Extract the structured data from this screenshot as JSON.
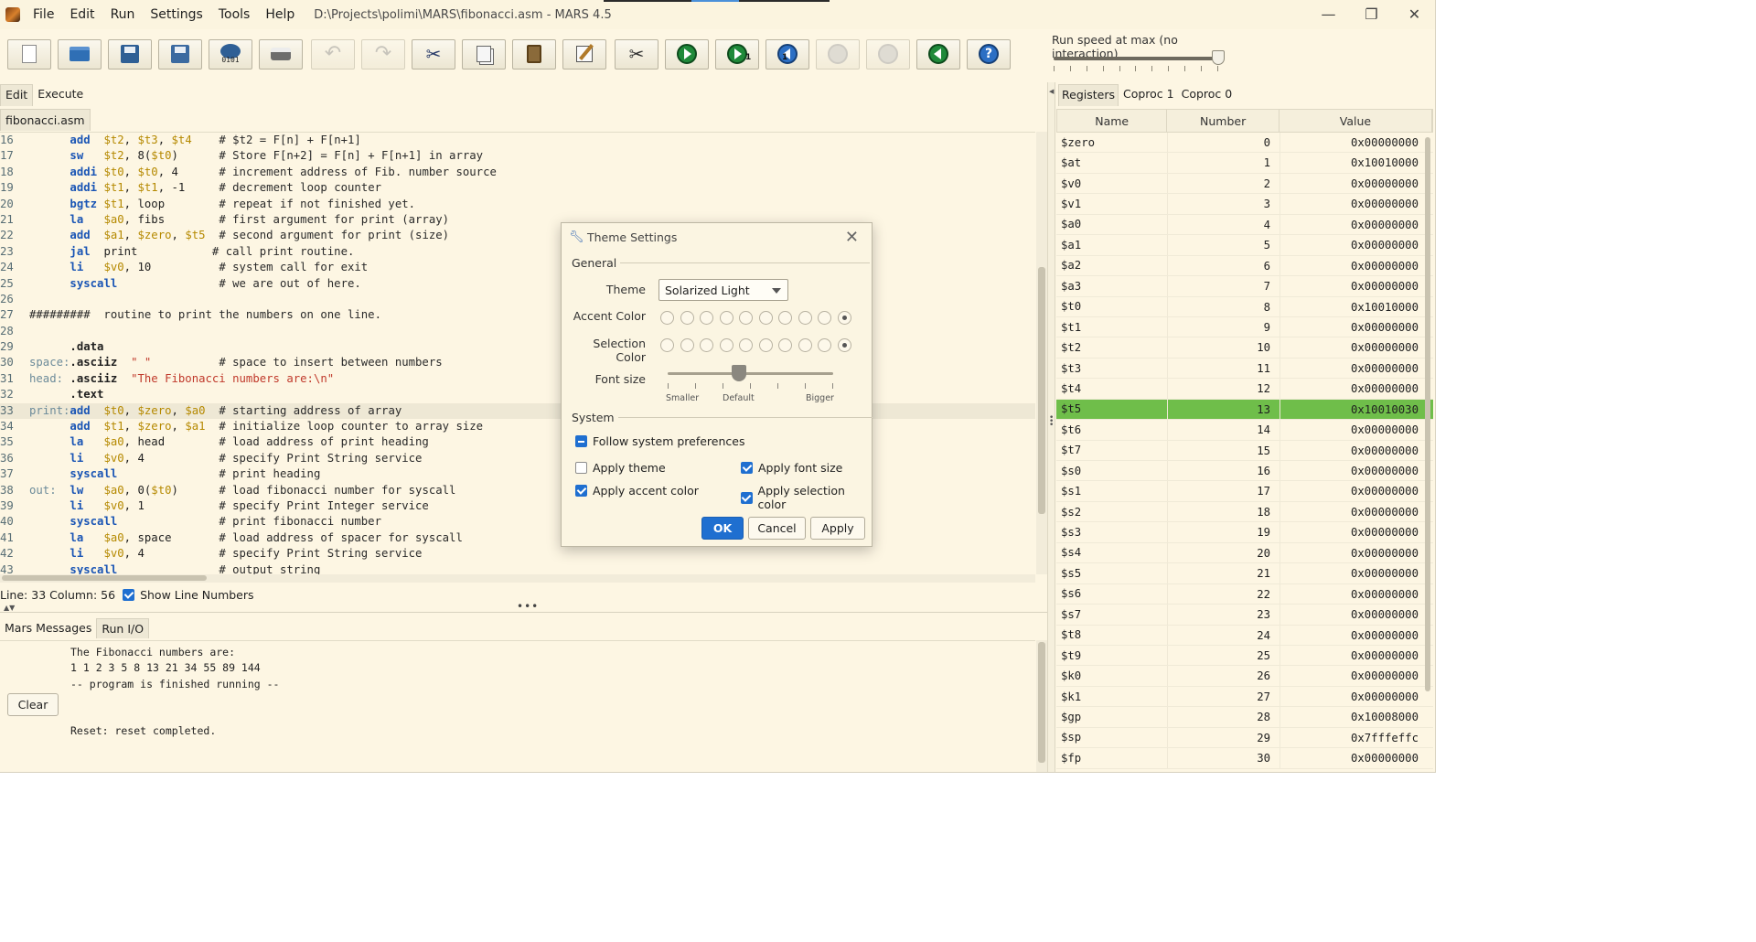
{
  "window": {
    "title": "D:\\Projects\\polimi\\MARS\\fibonacci.asm - MARS 4.5",
    "menu": [
      "File",
      "Edit",
      "Run",
      "Settings",
      "Tools",
      "Help"
    ],
    "controls": {
      "minimize": "—",
      "maximize": "❐",
      "close": "✕"
    }
  },
  "toolbar": {
    "buttons": [
      {
        "name": "new-file",
        "icon": "new-file-icon",
        "enabled": true
      },
      {
        "name": "open-file",
        "icon": "folder-icon",
        "enabled": true
      },
      {
        "name": "save",
        "icon": "save-icon",
        "enabled": true
      },
      {
        "name": "save-as",
        "icon": "save-as-icon",
        "enabled": true
      },
      {
        "name": "dump-memory",
        "icon": "dump-icon",
        "label": "0101",
        "enabled": true
      },
      {
        "name": "print",
        "icon": "printer-icon",
        "enabled": true
      },
      {
        "name": "undo",
        "icon": "undo-icon",
        "enabled": false
      },
      {
        "name": "redo",
        "icon": "redo-icon",
        "enabled": false
      },
      {
        "name": "cut",
        "icon": "scissors-icon",
        "enabled": true
      },
      {
        "name": "copy",
        "icon": "copy-icon",
        "enabled": true
      },
      {
        "name": "paste",
        "icon": "paste-icon",
        "enabled": true
      },
      {
        "name": "find-replace",
        "icon": "edit-icon",
        "enabled": true
      },
      {
        "name": "assemble",
        "icon": "tools-icon",
        "enabled": true
      },
      {
        "name": "run",
        "icon": "run-icon",
        "enabled": true
      },
      {
        "name": "step",
        "icon": "step-icon",
        "label": "1",
        "enabled": true
      },
      {
        "name": "backstep",
        "icon": "backstep-icon",
        "label": "1",
        "enabled": true
      },
      {
        "name": "pause",
        "icon": "pause-icon",
        "enabled": false
      },
      {
        "name": "stop",
        "icon": "stop-icon",
        "enabled": false
      },
      {
        "name": "reset",
        "icon": "reset-icon",
        "enabled": true
      },
      {
        "name": "help",
        "icon": "help-icon",
        "label": "?",
        "enabled": true
      }
    ]
  },
  "run_speed": {
    "label": "Run speed at max (no interaction)",
    "value_fraction": 1.0
  },
  "left_tabs": [
    "Edit",
    "Execute"
  ],
  "file_tab": "fibonacci.asm",
  "editor": {
    "current_line": 33,
    "lines": [
      {
        "n": "16",
        "parts": [
          [
            "plain",
            "      "
          ],
          [
            "op",
            "add"
          ],
          [
            "plain",
            "  "
          ],
          [
            "reg",
            "$t2"
          ],
          [
            "plain",
            ", "
          ],
          [
            "reg",
            "$t3"
          ],
          [
            "plain",
            ", "
          ],
          [
            "reg",
            "$t4"
          ],
          [
            "plain",
            "    "
          ],
          [
            "cmt",
            "# $t2 = F[n] + F[n+1]"
          ]
        ]
      },
      {
        "n": "17",
        "parts": [
          [
            "plain",
            "      "
          ],
          [
            "op",
            "sw"
          ],
          [
            "plain",
            "   "
          ],
          [
            "reg",
            "$t2"
          ],
          [
            "plain",
            ", 8("
          ],
          [
            "reg",
            "$t0"
          ],
          [
            "plain",
            ")      "
          ],
          [
            "cmt",
            "# Store F[n+2] = F[n] + F[n+1] in array"
          ]
        ]
      },
      {
        "n": "18",
        "parts": [
          [
            "plain",
            "      "
          ],
          [
            "op",
            "addi"
          ],
          [
            "plain",
            " "
          ],
          [
            "reg",
            "$t0"
          ],
          [
            "plain",
            ", "
          ],
          [
            "reg",
            "$t0"
          ],
          [
            "plain",
            ", 4      "
          ],
          [
            "cmt",
            "# increment address of Fib. number source"
          ]
        ]
      },
      {
        "n": "19",
        "parts": [
          [
            "plain",
            "      "
          ],
          [
            "op",
            "addi"
          ],
          [
            "plain",
            " "
          ],
          [
            "reg",
            "$t1"
          ],
          [
            "plain",
            ", "
          ],
          [
            "reg",
            "$t1"
          ],
          [
            "plain",
            ", -1     "
          ],
          [
            "cmt",
            "# decrement loop counter"
          ]
        ]
      },
      {
        "n": "20",
        "parts": [
          [
            "plain",
            "      "
          ],
          [
            "op",
            "bgtz"
          ],
          [
            "plain",
            " "
          ],
          [
            "reg",
            "$t1"
          ],
          [
            "plain",
            ", loop        "
          ],
          [
            "cmt",
            "# repeat if not finished yet."
          ]
        ]
      },
      {
        "n": "21",
        "parts": [
          [
            "plain",
            "      "
          ],
          [
            "op",
            "la"
          ],
          [
            "plain",
            "   "
          ],
          [
            "reg",
            "$a0"
          ],
          [
            "plain",
            ", fibs        "
          ],
          [
            "cmt",
            "# first argument for print (array)"
          ]
        ]
      },
      {
        "n": "22",
        "parts": [
          [
            "plain",
            "      "
          ],
          [
            "op",
            "add"
          ],
          [
            "plain",
            "  "
          ],
          [
            "reg",
            "$a1"
          ],
          [
            "plain",
            ", "
          ],
          [
            "reg",
            "$zero"
          ],
          [
            "plain",
            ", "
          ],
          [
            "reg",
            "$t5"
          ],
          [
            "plain",
            "  "
          ],
          [
            "cmt",
            "# second argument for print (size)"
          ]
        ]
      },
      {
        "n": "23",
        "parts": [
          [
            "plain",
            "      "
          ],
          [
            "op",
            "jal"
          ],
          [
            "plain",
            "  print           "
          ],
          [
            "cmt",
            "# call print routine."
          ]
        ]
      },
      {
        "n": "24",
        "parts": [
          [
            "plain",
            "      "
          ],
          [
            "op",
            "li"
          ],
          [
            "plain",
            "   "
          ],
          [
            "reg",
            "$v0"
          ],
          [
            "plain",
            ", 10          "
          ],
          [
            "cmt",
            "# system call for exit"
          ]
        ]
      },
      {
        "n": "25",
        "parts": [
          [
            "plain",
            "      "
          ],
          [
            "op",
            "syscall"
          ],
          [
            "plain",
            "               "
          ],
          [
            "cmt",
            "# we are out of here."
          ]
        ]
      },
      {
        "n": "26",
        "parts": [
          [
            "plain",
            ""
          ]
        ]
      },
      {
        "n": "27",
        "parts": [
          [
            "cmt",
            "#########  routine to print the numbers on one line."
          ]
        ]
      },
      {
        "n": "28",
        "parts": [
          [
            "plain",
            ""
          ]
        ]
      },
      {
        "n": "29",
        "parts": [
          [
            "plain",
            "      "
          ],
          [
            "dir",
            ".data"
          ]
        ]
      },
      {
        "n": "30",
        "parts": [
          [
            "lbl",
            "space:"
          ],
          [
            "dir",
            ".asciiz"
          ],
          [
            "plain",
            "  "
          ],
          [
            "str",
            "\" \""
          ],
          [
            "plain",
            "          "
          ],
          [
            "cmt",
            "# space to insert between numbers"
          ]
        ]
      },
      {
        "n": "31",
        "parts": [
          [
            "lbl",
            "head: "
          ],
          [
            "dir",
            ".asciiz"
          ],
          [
            "plain",
            "  "
          ],
          [
            "str",
            "\"The Fibonacci numbers are:\\n\""
          ]
        ]
      },
      {
        "n": "32",
        "parts": [
          [
            "plain",
            "      "
          ],
          [
            "dir",
            ".text"
          ]
        ]
      },
      {
        "n": "33",
        "parts": [
          [
            "lbl",
            "print:"
          ],
          [
            "op",
            "add"
          ],
          [
            "plain",
            "  "
          ],
          [
            "reg",
            "$t0"
          ],
          [
            "plain",
            ", "
          ],
          [
            "reg",
            "$zero"
          ],
          [
            "plain",
            ", "
          ],
          [
            "reg",
            "$a0"
          ],
          [
            "plain",
            "  "
          ],
          [
            "cmt",
            "# starting address of array"
          ]
        ]
      },
      {
        "n": "34",
        "parts": [
          [
            "plain",
            "      "
          ],
          [
            "op",
            "add"
          ],
          [
            "plain",
            "  "
          ],
          [
            "reg",
            "$t1"
          ],
          [
            "plain",
            ", "
          ],
          [
            "reg",
            "$zero"
          ],
          [
            "plain",
            ", "
          ],
          [
            "reg",
            "$a1"
          ],
          [
            "plain",
            "  "
          ],
          [
            "cmt",
            "# initialize loop counter to array size"
          ]
        ]
      },
      {
        "n": "35",
        "parts": [
          [
            "plain",
            "      "
          ],
          [
            "op",
            "la"
          ],
          [
            "plain",
            "   "
          ],
          [
            "reg",
            "$a0"
          ],
          [
            "plain",
            ", head        "
          ],
          [
            "cmt",
            "# load address of print heading"
          ]
        ]
      },
      {
        "n": "36",
        "parts": [
          [
            "plain",
            "      "
          ],
          [
            "op",
            "li"
          ],
          [
            "plain",
            "   "
          ],
          [
            "reg",
            "$v0"
          ],
          [
            "plain",
            ", 4           "
          ],
          [
            "cmt",
            "# specify Print String service"
          ]
        ]
      },
      {
        "n": "37",
        "parts": [
          [
            "plain",
            "      "
          ],
          [
            "op",
            "syscall"
          ],
          [
            "plain",
            "               "
          ],
          [
            "cmt",
            "# print heading"
          ]
        ]
      },
      {
        "n": "38",
        "parts": [
          [
            "lbl",
            "out:  "
          ],
          [
            "op",
            "lw"
          ],
          [
            "plain",
            "   "
          ],
          [
            "reg",
            "$a0"
          ],
          [
            "plain",
            ", 0("
          ],
          [
            "reg",
            "$t0"
          ],
          [
            "plain",
            ")      "
          ],
          [
            "cmt",
            "# load fibonacci number for syscall"
          ]
        ]
      },
      {
        "n": "39",
        "parts": [
          [
            "plain",
            "      "
          ],
          [
            "op",
            "li"
          ],
          [
            "plain",
            "   "
          ],
          [
            "reg",
            "$v0"
          ],
          [
            "plain",
            ", 1           "
          ],
          [
            "cmt",
            "# specify Print Integer service"
          ]
        ]
      },
      {
        "n": "40",
        "parts": [
          [
            "plain",
            "      "
          ],
          [
            "op",
            "syscall"
          ],
          [
            "plain",
            "               "
          ],
          [
            "cmt",
            "# print fibonacci number"
          ]
        ]
      },
      {
        "n": "41",
        "parts": [
          [
            "plain",
            "      "
          ],
          [
            "op",
            "la"
          ],
          [
            "plain",
            "   "
          ],
          [
            "reg",
            "$a0"
          ],
          [
            "plain",
            ", space       "
          ],
          [
            "cmt",
            "# load address of spacer for syscall"
          ]
        ]
      },
      {
        "n": "42",
        "parts": [
          [
            "plain",
            "      "
          ],
          [
            "op",
            "li"
          ],
          [
            "plain",
            "   "
          ],
          [
            "reg",
            "$v0"
          ],
          [
            "plain",
            ", 4           "
          ],
          [
            "cmt",
            "# specify Print String service"
          ]
        ]
      },
      {
        "n": "43",
        "parts": [
          [
            "plain",
            "      "
          ],
          [
            "op",
            "syscall"
          ],
          [
            "plain",
            "               "
          ],
          [
            "cmt",
            "# output string"
          ]
        ]
      }
    ]
  },
  "status": {
    "position": "Line: 33 Column: 56",
    "show_line_numbers_label": "Show Line Numbers",
    "show_line_numbers": true
  },
  "bottom_tabs": [
    "Mars Messages",
    "Run I/O"
  ],
  "console": {
    "lines": [
      "The Fibonacci numbers are:",
      "1 1 2 3 5 8 13 21 34 55 89 144",
      "-- program is finished running --",
      "",
      "",
      "Reset: reset completed."
    ],
    "clear_label": "Clear"
  },
  "registers": {
    "tabs": [
      "Registers",
      "Coproc 1",
      "Coproc 0"
    ],
    "headers": [
      "Name",
      "Number",
      "Value"
    ],
    "highlight_color": "#6fbe4a",
    "rows": [
      {
        "name": "$zero",
        "number": "0",
        "value": "0x00000000"
      },
      {
        "name": "$at",
        "number": "1",
        "value": "0x10010000"
      },
      {
        "name": "$v0",
        "number": "2",
        "value": "0x00000000"
      },
      {
        "name": "$v1",
        "number": "3",
        "value": "0x00000000"
      },
      {
        "name": "$a0",
        "number": "4",
        "value": "0x00000000"
      },
      {
        "name": "$a1",
        "number": "5",
        "value": "0x00000000"
      },
      {
        "name": "$a2",
        "number": "6",
        "value": "0x00000000"
      },
      {
        "name": "$a3",
        "number": "7",
        "value": "0x00000000"
      },
      {
        "name": "$t0",
        "number": "8",
        "value": "0x10010000"
      },
      {
        "name": "$t1",
        "number": "9",
        "value": "0x00000000"
      },
      {
        "name": "$t2",
        "number": "10",
        "value": "0x00000000"
      },
      {
        "name": "$t3",
        "number": "11",
        "value": "0x00000000"
      },
      {
        "name": "$t4",
        "number": "12",
        "value": "0x00000000"
      },
      {
        "name": "$t5",
        "number": "13",
        "value": "0x10010030",
        "highlight": true
      },
      {
        "name": "$t6",
        "number": "14",
        "value": "0x00000000"
      },
      {
        "name": "$t7",
        "number": "15",
        "value": "0x00000000"
      },
      {
        "name": "$s0",
        "number": "16",
        "value": "0x00000000"
      },
      {
        "name": "$s1",
        "number": "17",
        "value": "0x00000000"
      },
      {
        "name": "$s2",
        "number": "18",
        "value": "0x00000000"
      },
      {
        "name": "$s3",
        "number": "19",
        "value": "0x00000000"
      },
      {
        "name": "$s4",
        "number": "20",
        "value": "0x00000000"
      },
      {
        "name": "$s5",
        "number": "21",
        "value": "0x00000000"
      },
      {
        "name": "$s6",
        "number": "22",
        "value": "0x00000000"
      },
      {
        "name": "$s7",
        "number": "23",
        "value": "0x00000000"
      },
      {
        "name": "$t8",
        "number": "24",
        "value": "0x00000000"
      },
      {
        "name": "$t9",
        "number": "25",
        "value": "0x00000000"
      },
      {
        "name": "$k0",
        "number": "26",
        "value": "0x00000000"
      },
      {
        "name": "$k1",
        "number": "27",
        "value": "0x00000000"
      },
      {
        "name": "$gp",
        "number": "28",
        "value": "0x10008000"
      },
      {
        "name": "$sp",
        "number": "29",
        "value": "0x7fffeffc"
      },
      {
        "name": "$fp",
        "number": "30",
        "value": "0x00000000"
      }
    ]
  },
  "dialog": {
    "title": "Theme Settings",
    "close": "✕",
    "general_label": "General",
    "theme_label": "Theme",
    "theme_value": "Solarized Light",
    "accent_label": "Accent Color",
    "selection_label": "Selection Color",
    "swatch_count": 10,
    "accent_selected_index": 9,
    "selection_selected_index": 9,
    "font_size_label": "Font size",
    "font_size_fraction": 0.43,
    "font_size_ticks": [
      "Smaller",
      "Default",
      "Bigger"
    ],
    "system_label": "System",
    "follow_system": {
      "label": "Follow system preferences",
      "state": "indeterminate"
    },
    "apply_theme": {
      "label": "Apply theme",
      "checked": false
    },
    "apply_font_size": {
      "label": "Apply font size",
      "checked": true
    },
    "apply_accent": {
      "label": "Apply accent color",
      "checked": true
    },
    "apply_selection": {
      "label": "Apply selection color",
      "checked": true
    },
    "ok_label": "OK",
    "cancel_label": "Cancel",
    "apply_label": "Apply"
  }
}
